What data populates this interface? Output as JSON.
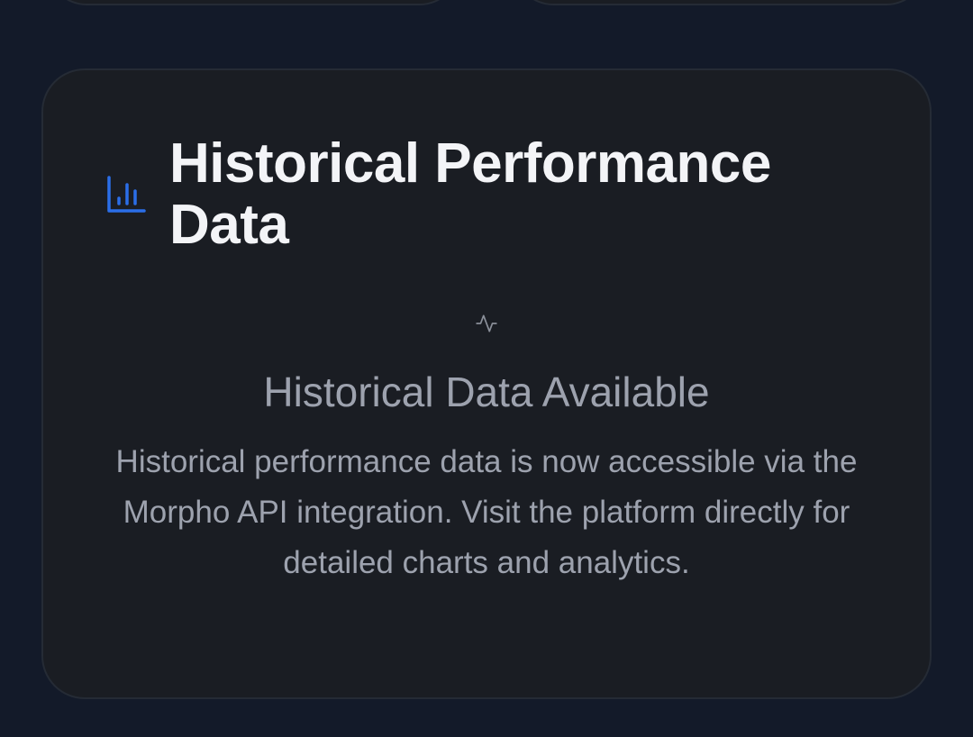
{
  "card": {
    "icon": "bar-chart-icon",
    "title": "Historical Performance Data"
  },
  "empty_state": {
    "icon": "activity-icon",
    "title": "Historical Data Available",
    "body": "Historical performance data is now accessible via the Morpho API integration. Visit the platform directly for detailed charts and analytics."
  },
  "colors": {
    "background": "#131a29",
    "card_background": "#1a1d23",
    "card_border": "#252b35",
    "accent": "#2b6ee8",
    "title_text": "#f3f4f7",
    "muted_text": "#9da2ae"
  }
}
